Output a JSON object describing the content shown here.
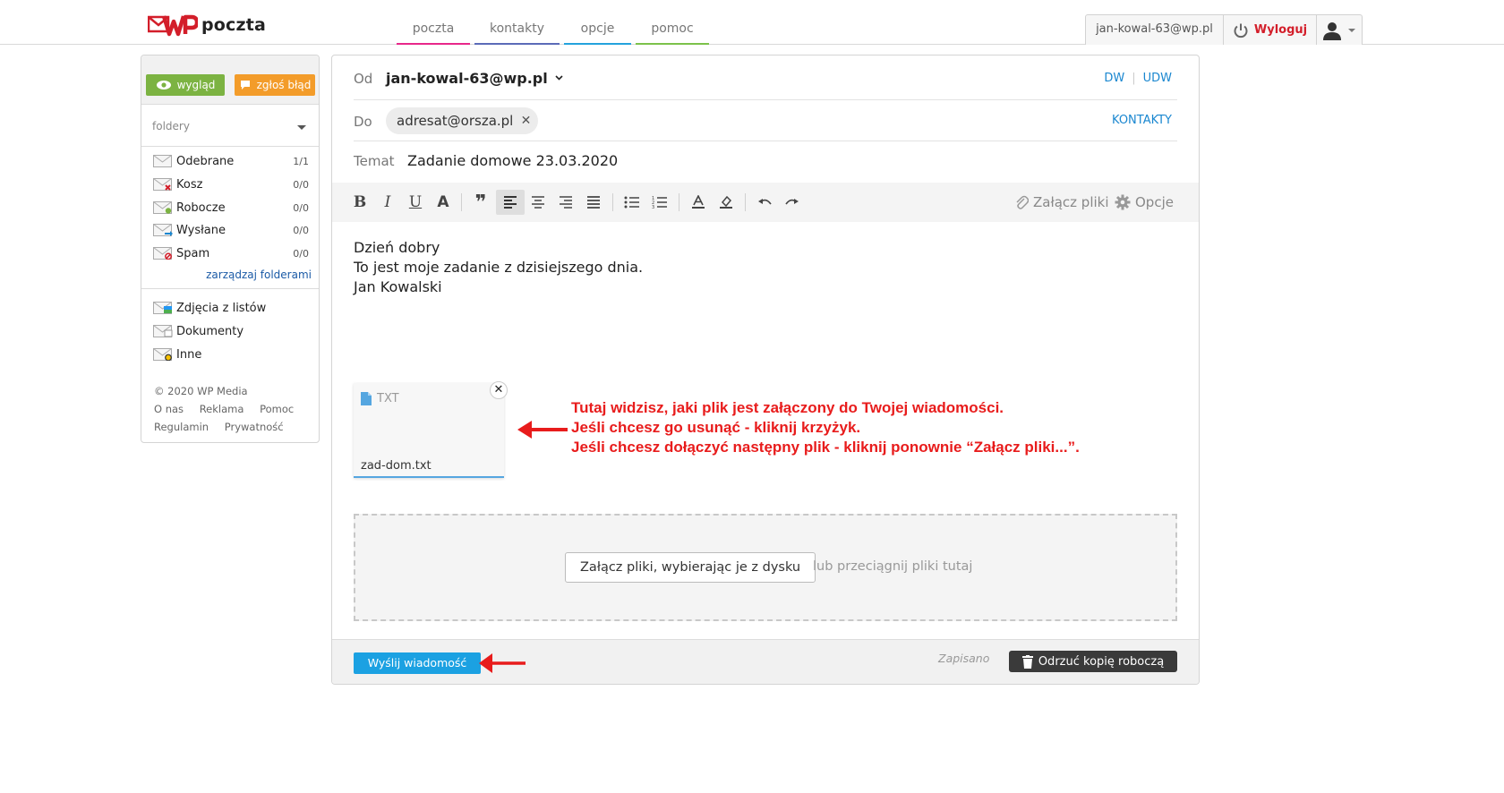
{
  "brand": {
    "name": "poczta"
  },
  "nav": {
    "tabs": [
      {
        "label": "poczta",
        "color": "#e8278a"
      },
      {
        "label": "kontakty",
        "color": "#5b6bb8"
      },
      {
        "label": "opcje",
        "color": "#24a3dd"
      },
      {
        "label": "pomoc",
        "color": "#7cc24a"
      }
    ]
  },
  "user": {
    "email": "jan-kowal-63@wp.pl",
    "logout_label": "Wyloguj"
  },
  "sidebar": {
    "view_button": "wygląd",
    "report_button": "zgłoś błąd",
    "folders_label": "foldery",
    "folders": [
      {
        "name": "Odebrane",
        "count": "1/1"
      },
      {
        "name": "Kosz",
        "count": "0/0"
      },
      {
        "name": "Robocze",
        "count": "0/0"
      },
      {
        "name": "Wysłane",
        "count": "0/0"
      },
      {
        "name": "Spam",
        "count": "0/0"
      }
    ],
    "manage_folders": "zarządzaj folderami",
    "special_folders": [
      {
        "name": "Zdjęcia z listów"
      },
      {
        "name": "Dokumenty"
      },
      {
        "name": "Inne"
      }
    ],
    "footer": {
      "copyright": "© 2020 WP Media",
      "links": [
        "O nas",
        "Reklama",
        "Pomoc",
        "Regulamin",
        "Prywatność"
      ]
    }
  },
  "compose": {
    "from_label": "Od",
    "from_value": "jan-kowal-63@wp.pl",
    "cc_label": "DW",
    "bcc_label": "UDW",
    "to_label": "Do",
    "recipient": "adresat@orsza.pl",
    "contacts_label": "KONTAKTY",
    "subject_label": "Temat",
    "subject": "Zadanie domowe 23.03.2020",
    "attach_label": "Załącz pliki",
    "options_label": "Opcje",
    "body_lines": [
      "Dzień dobry",
      "To jest moje zadanie z dzisiejszego dnia.",
      "Jan Kowalski"
    ],
    "attachment": {
      "type": "TXT",
      "filename": "zad-dom.txt"
    },
    "dropzone_button": "Załącz pliki, wybierając je z dysku",
    "dropzone_hint": "lub przeciągnij pliki tutaj",
    "send_label": "Wyślij wiadomość",
    "saved_status": "Zapisano",
    "discard_label": "Odrzuć kopię roboczą"
  },
  "annotation": {
    "lines": [
      "Tutaj widzisz, jaki plik jest załączony do Twojej wiadomości.",
      "Jeśli chcesz go usunąć - kliknij krzyżyk.",
      "Jeśli chcesz dołączyć następny plik - kliknij ponownie “Załącz pliki...”."
    ],
    "color": "#e81c1c"
  },
  "colors": {
    "accent_blue": "#1ba1e2",
    "link_blue": "#1a87d0",
    "brand_red": "#d31e2a",
    "view_green": "#7cb342",
    "report_orange": "#f39c2a"
  }
}
